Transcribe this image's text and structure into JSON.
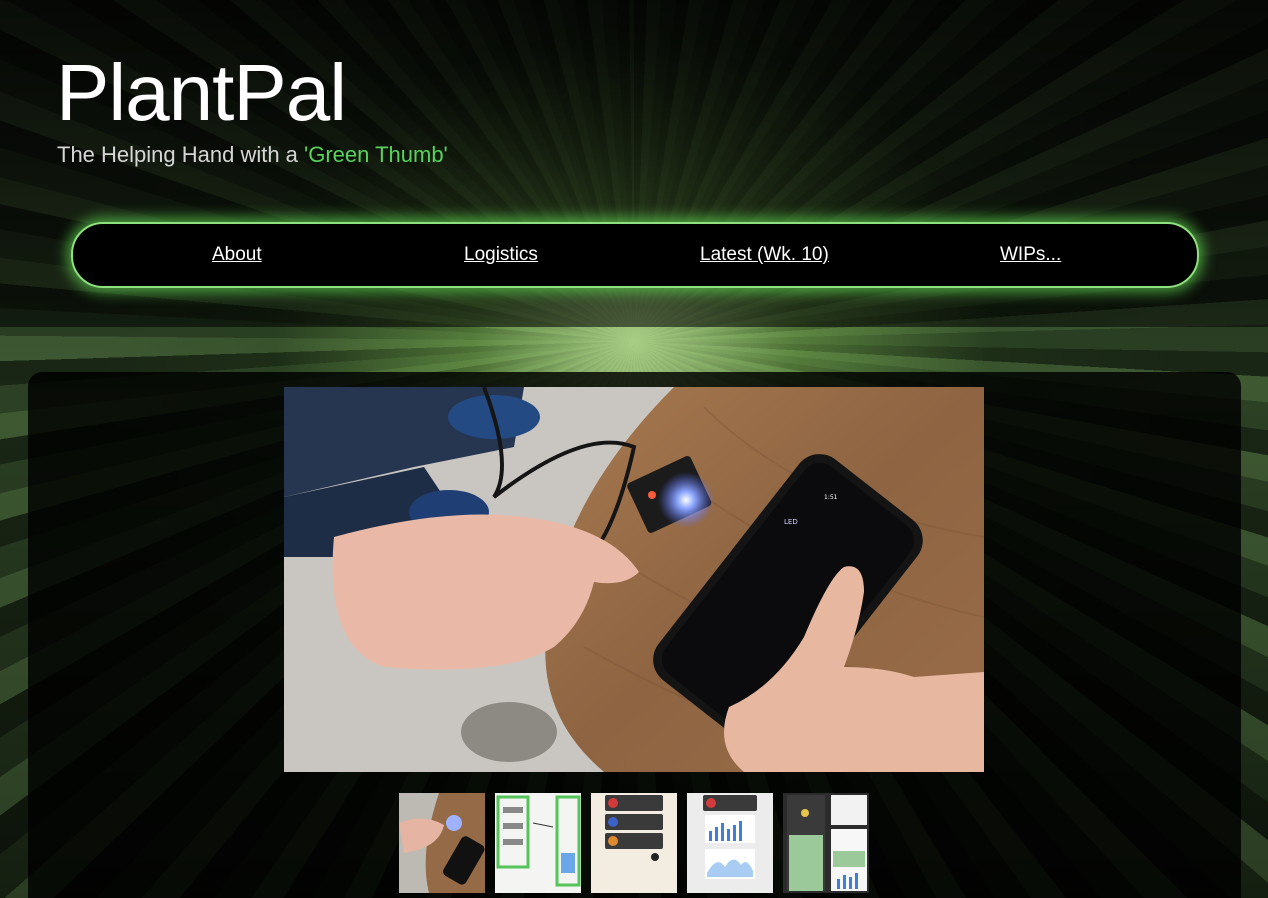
{
  "header": {
    "title": "PlantPal",
    "subtitle_prefix": "The Helping Hand with a ",
    "subtitle_accent": "'Green Thumb'"
  },
  "nav": {
    "items": [
      {
        "label": "About"
      },
      {
        "label": "Logistics"
      },
      {
        "label": "Latest (Wk. 10)"
      },
      {
        "label": "WIPs..."
      }
    ]
  },
  "gallery": {
    "main_image": {
      "phone_screen_label": "LED",
      "phone_status": "1:51"
    },
    "thumbnails": [
      {
        "name": "led-demo-photo"
      },
      {
        "name": "wireframe-sketch"
      },
      {
        "name": "plant-list-mockup"
      },
      {
        "name": "charts-mockup"
      },
      {
        "name": "app-screens-mockup"
      }
    ]
  },
  "colors": {
    "accent": "#58d25c",
    "nav_glow": "#8fe07f",
    "nav_background": "#000000"
  }
}
